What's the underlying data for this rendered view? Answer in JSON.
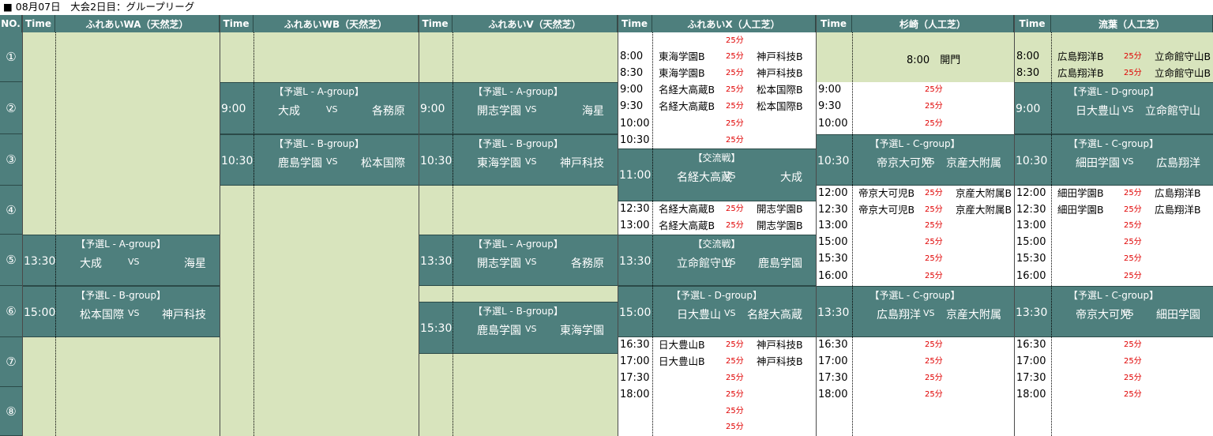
{
  "title": "■ 08月07日　大会2日目：グループリーグ",
  "header": {
    "no": "NO.",
    "time": "Time",
    "fields": [
      "ふれあいWA（天然芝）",
      "ふれあいWB（天然芝）",
      "ふれあいV（天然芝）",
      "ふれあいX（人工芝）",
      "杉崎（人工芝）",
      "流葉（人工芝）"
    ]
  },
  "rows": [
    "①",
    "②",
    "③",
    "④",
    "⑤",
    "⑥",
    "⑦",
    "⑧"
  ],
  "duration": "25分",
  "vs": "VS",
  "kaimon": "8:00　開門",
  "matches": [
    {
      "col": 0,
      "row": 4,
      "group": "【予選L - A-group】",
      "time": "13:30",
      "home": "大成",
      "away": "海星"
    },
    {
      "col": 0,
      "row": 5,
      "group": "【予選L - B-group】",
      "time": "15:00",
      "home": "松本国際",
      "away": "神戸科技"
    },
    {
      "col": 1,
      "row": 1,
      "group": "【予選L - A-group】",
      "time": "9:00",
      "home": "大成",
      "away": "各務原"
    },
    {
      "col": 1,
      "row": 2,
      "group": "【予選L - B-group】",
      "time": "10:30",
      "home": "鹿島学園",
      "away": "松本国際"
    },
    {
      "col": 2,
      "row": 1,
      "group": "【予選L - A-group】",
      "time": "9:00",
      "home": "開志学園",
      "away": "海星"
    },
    {
      "col": 2,
      "row": 2,
      "group": "【予選L - B-group】",
      "time": "10:30",
      "home": "東海学園",
      "away": "神戸科技"
    },
    {
      "col": 2,
      "row": 4,
      "group": "【予選L - A-group】",
      "time": "13:30",
      "home": "開志学園",
      "away": "各務原"
    },
    {
      "col": 2,
      "row": "6b",
      "group": "【予選L - B-group】",
      "time": "15:30",
      "home": "鹿島学園",
      "away": "東海学園"
    },
    {
      "col": 3,
      "row": "3x",
      "group": "【交流戦】",
      "time": "11:00",
      "home": "名経大高蔵",
      "away": "大成"
    },
    {
      "col": 3,
      "row": 4,
      "group": "【交流戦】",
      "time": "13:30",
      "home": "立命館守山",
      "away": "鹿島学園"
    },
    {
      "col": 3,
      "row": 5,
      "group": "【予選L - D-group】",
      "time": "15:00",
      "home": "日大豊山",
      "away": "名経大高蔵"
    },
    {
      "col": 4,
      "row": 2,
      "group": "【予選L - C-group】",
      "time": "10:30",
      "home": "帝京大可児",
      "away": "京産大附属"
    },
    {
      "col": 4,
      "row": 5,
      "group": "【予選L - C-group】",
      "time": "13:30",
      "home": "広島翔洋",
      "away": "京産大附属"
    },
    {
      "col": 5,
      "row": 1,
      "group": "【予選L - D-group】",
      "time": "9:00",
      "home": "日大豊山",
      "away": "立命館守山"
    },
    {
      "col": 5,
      "row": 2,
      "group": "【予選L - C-group】",
      "time": "10:30",
      "home": "細田学園",
      "away": "広島翔洋"
    },
    {
      "col": 5,
      "row": 5,
      "group": "【予選L - C-group】",
      "time": "13:30",
      "home": "帝京大可児",
      "away": "細田学園"
    }
  ],
  "slots": {
    "x": [
      {
        "time": "",
        "home": "",
        "away": ""
      },
      {
        "time": "8:00",
        "home": "東海学園B",
        "away": "神戸科技B"
      },
      {
        "time": "8:30",
        "home": "東海学園B",
        "away": "神戸科技B"
      },
      {
        "time": "9:00",
        "home": "名経大高蔵B",
        "away": "松本国際B"
      },
      {
        "time": "9:30",
        "home": "名経大高蔵B",
        "away": "松本国際B"
      },
      {
        "time": "10:00",
        "home": "",
        "away": ""
      },
      {
        "time": "10:30",
        "home": "",
        "away": ""
      },
      {
        "time": "12:30",
        "home": "名経大高蔵B",
        "away": "開志学園B"
      },
      {
        "time": "13:00",
        "home": "名経大高蔵B",
        "away": "開志学園B"
      },
      {
        "time": "16:30",
        "home": "日大豊山B",
        "away": "神戸科技B"
      },
      {
        "time": "17:00",
        "home": "日大豊山B",
        "away": "神戸科技B"
      },
      {
        "time": "17:30",
        "home": "",
        "away": ""
      },
      {
        "time": "18:00",
        "home": "",
        "away": ""
      },
      {
        "time": "",
        "home": "",
        "away": ""
      },
      {
        "time": "",
        "home": "",
        "away": ""
      }
    ],
    "sugisaki": [
      {
        "time": "9:00",
        "home": "",
        "away": ""
      },
      {
        "time": "9:30",
        "home": "",
        "away": ""
      },
      {
        "time": "10:00",
        "home": "",
        "away": ""
      },
      {
        "time": "12:00",
        "home": "帝京大可児B",
        "away": "京産大附属B"
      },
      {
        "time": "12:30",
        "home": "帝京大可児B",
        "away": "京産大附属B"
      },
      {
        "time": "13:00",
        "home": "",
        "away": ""
      },
      {
        "time": "15:00",
        "home": "",
        "away": ""
      },
      {
        "time": "15:30",
        "home": "",
        "away": ""
      },
      {
        "time": "16:00",
        "home": "",
        "away": ""
      },
      {
        "time": "16:30",
        "home": "",
        "away": ""
      },
      {
        "time": "17:00",
        "home": "",
        "away": ""
      },
      {
        "time": "17:30",
        "home": "",
        "away": ""
      },
      {
        "time": "18:00",
        "home": "",
        "away": ""
      }
    ],
    "nagareha": [
      {
        "time": "8:00",
        "home": "広島翔洋B",
        "away": "立命館守山B"
      },
      {
        "time": "8:30",
        "home": "広島翔洋B",
        "away": "立命館守山B"
      },
      {
        "time": "12:00",
        "home": "細田学園B",
        "away": "広島翔洋B"
      },
      {
        "time": "12:30",
        "home": "細田学園B",
        "away": "広島翔洋B"
      },
      {
        "time": "13:00",
        "home": "",
        "away": ""
      },
      {
        "time": "15:00",
        "home": "",
        "away": ""
      },
      {
        "time": "15:30",
        "home": "",
        "away": ""
      },
      {
        "time": "16:00",
        "home": "",
        "away": ""
      },
      {
        "time": "16:30",
        "home": "",
        "away": ""
      },
      {
        "time": "17:00",
        "home": "",
        "away": ""
      },
      {
        "time": "17:30",
        "home": "",
        "away": ""
      },
      {
        "time": "18:00",
        "home": "",
        "away": ""
      }
    ]
  }
}
